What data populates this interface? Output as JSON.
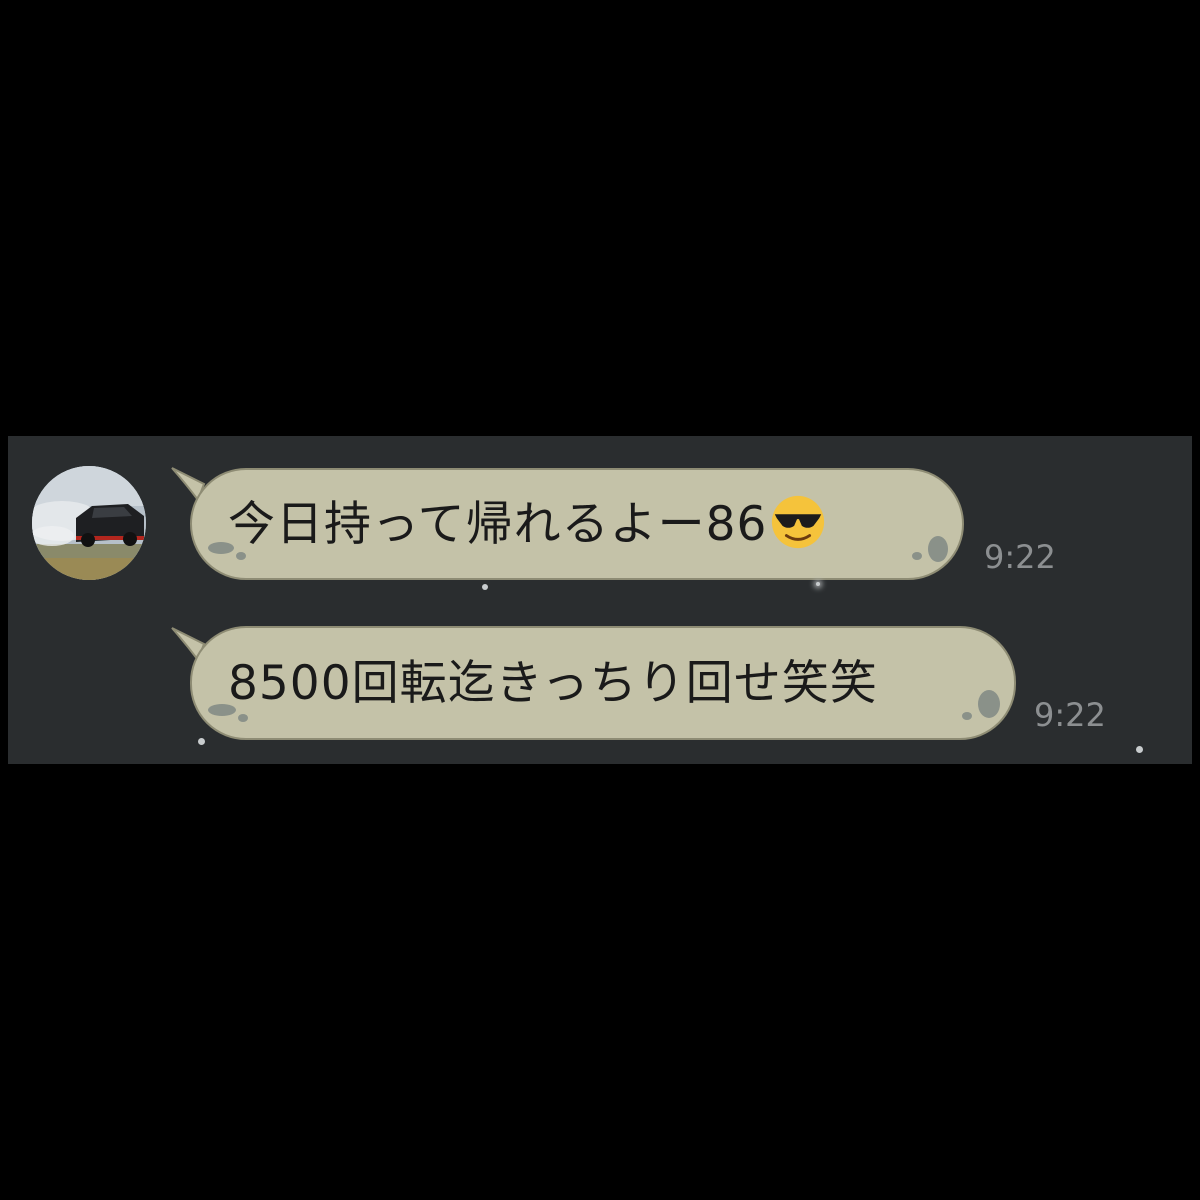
{
  "chat": {
    "messages": [
      {
        "text": "今日持って帰れるよー86",
        "emoji": "sunglasses-face",
        "time": "9:22"
      },
      {
        "text": "8500回転迄きっちり回せ笑笑",
        "time": "9:22"
      }
    ],
    "avatar": "drift-car-photo"
  },
  "colors": {
    "background": "#000000",
    "chat_background": "#2a2d2f",
    "bubble_fill": "#c4c2a8",
    "bubble_border": "#8e8c74",
    "timestamp": "#8c8f91"
  }
}
